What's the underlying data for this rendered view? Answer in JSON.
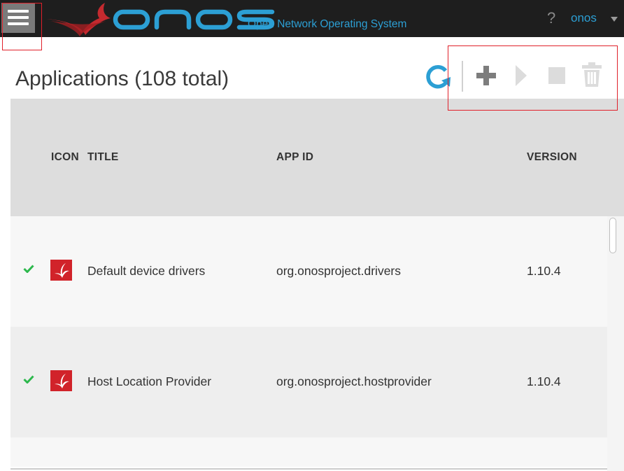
{
  "header": {
    "logo_text": "onos",
    "tagline": "Open Network Operating System",
    "help_label": "?",
    "user_name": "onos",
    "menu_icon": "hamburger-menu-icon"
  },
  "page": {
    "title": "Applications (108 total)"
  },
  "toolbar": {
    "icons": [
      "refresh-icon",
      "plus-icon",
      "play-icon",
      "stop-icon",
      "trash-icon"
    ]
  },
  "table": {
    "columns": [
      "ICON",
      "TITLE",
      "APP ID",
      "VERSION"
    ],
    "rows": [
      {
        "status": "check-icon",
        "title": "Default device drivers",
        "app_id": "org.onosproject.drivers",
        "version": "1.10.4"
      },
      {
        "status": "check-icon",
        "title": "Host Location Provider",
        "app_id": "org.onosproject.hostprovider",
        "version": "1.10.4"
      }
    ]
  },
  "colors": {
    "accent": "#2c9fd4",
    "brand_red": "#d1232a",
    "topbar_bg": "#1e1e1e",
    "highlight_box": "#e0202a",
    "status_green": "#2db84d"
  }
}
